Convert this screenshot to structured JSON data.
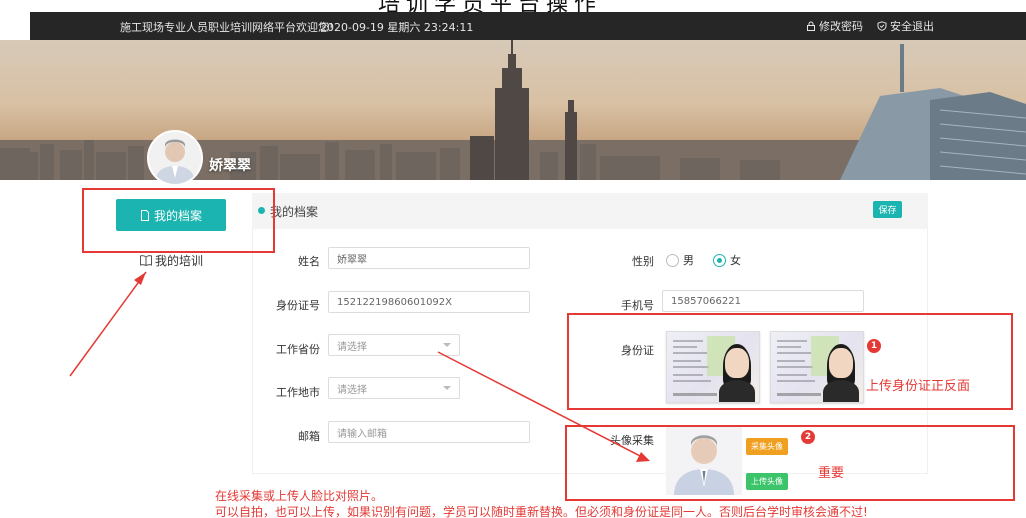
{
  "caption": {
    "text": "培训学员平台操作"
  },
  "topbar": {
    "welcome": "施工现场专业人员职业培训网络平台欢迎您!",
    "datetime": "2020-09-19 星期六 23:24:11",
    "change_password": "修改密码",
    "logout": "安全退出",
    "lock_icon": "lock-icon",
    "logout_icon": "shield-check-icon"
  },
  "user": {
    "name": "娇翠翠"
  },
  "sidebar": {
    "items": [
      {
        "label": "我的档案",
        "icon": "document-icon",
        "active": true
      },
      {
        "label": "我的培训",
        "icon": "book-icon",
        "active": false
      }
    ]
  },
  "panel": {
    "title": "我的档案",
    "save_label": "保存"
  },
  "form": {
    "name": {
      "label": "姓名",
      "value": "娇翠翠"
    },
    "gender": {
      "label": "性别",
      "options": [
        "男",
        "女"
      ],
      "selected": "女"
    },
    "id_number": {
      "label": "身份证号",
      "value": "15212219860601092X"
    },
    "phone": {
      "label": "手机号",
      "value": "15857066221"
    },
    "work_province": {
      "label": "工作省份",
      "placeholder": "请选择"
    },
    "work_city": {
      "label": "工作地市",
      "placeholder": "请选择"
    },
    "email": {
      "label": "邮箱",
      "placeholder": "请输入邮箱"
    },
    "id_card": {
      "label": "身份证"
    },
    "head_capture": {
      "label": "头像采集",
      "capture_button": "采集头像",
      "upload_button": "上传头像"
    }
  },
  "annotations": {
    "badge1": "1",
    "badge2": "2",
    "id_note": "上传身份证正反面",
    "important_note": "重要",
    "bottom_line1": "在线采集或上传人脸比对照片。",
    "bottom_line2": "可以自拍，也可以上传，如果识别有问题，学员可以随时重新替换。但必须和身份证是同一人。否则后台学时审核会通不过!"
  },
  "colors": {
    "accent": "#1cb4b0",
    "annotation": "#e53935",
    "topbar": "#262626",
    "capture_button": "#f0a020",
    "upload_button": "#3cc46a"
  }
}
